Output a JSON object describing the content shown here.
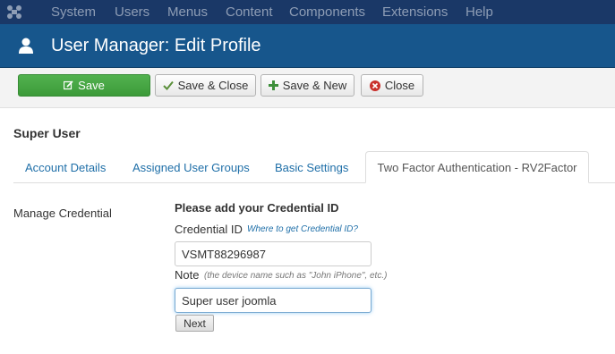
{
  "topbar": {
    "logo_icon": "joomla-logo-icon",
    "menu": [
      {
        "label": "System"
      },
      {
        "label": "Users"
      },
      {
        "label": "Menus"
      },
      {
        "label": "Content"
      },
      {
        "label": "Components"
      },
      {
        "label": "Extensions"
      },
      {
        "label": "Help"
      }
    ]
  },
  "header": {
    "icon": "user-icon",
    "title": "User Manager: Edit Profile"
  },
  "toolbar": {
    "save_label": "Save",
    "save_close_label": "Save & Close",
    "save_new_label": "Save & New",
    "close_label": "Close"
  },
  "main": {
    "section_title": "Super User",
    "tabs": [
      {
        "label": "Account Details"
      },
      {
        "label": "Assigned User Groups"
      },
      {
        "label": "Basic Settings"
      },
      {
        "label": "Two Factor Authentication - RV2Factor",
        "active": true
      }
    ],
    "manage_label": "Manage Credential",
    "form_title": "Please add your Credential ID",
    "credential_label": "Credential ID",
    "credential_link": "Where to get Credential ID?",
    "credential_value": "VSMT88296987",
    "note_label": "Note",
    "note_hint": "(the device name such as \"John iPhone\", etc.)",
    "note_value": "Super user joomla",
    "next_label": "Next"
  },
  "colors": {
    "topbar": "#1a3867",
    "titlebar": "#17568c",
    "save_green": "#46a546",
    "close_red": "#c9302c",
    "link_blue": "#1f6fa8"
  }
}
